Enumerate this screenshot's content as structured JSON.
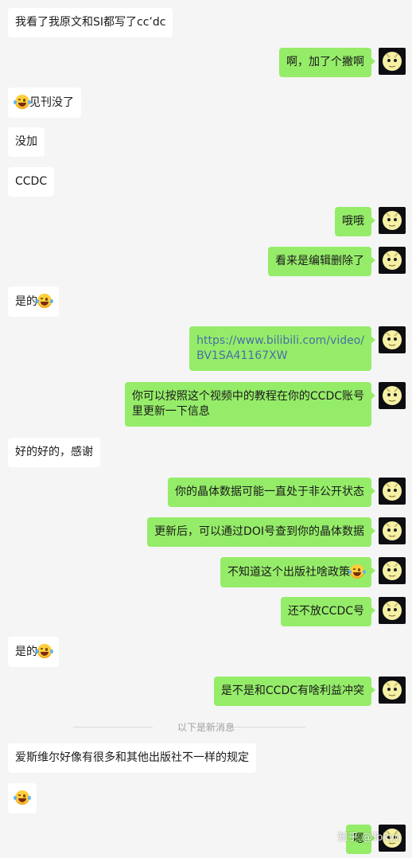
{
  "messages": [
    {
      "side": "in",
      "text": "我看了我原文和SI都写了cc’dc"
    },
    {
      "side": "out",
      "text": "啊，加了个撇啊"
    },
    {
      "side": "in",
      "text": "见刊没了",
      "emoji_before": true
    },
    {
      "side": "in",
      "text": "没加"
    },
    {
      "side": "in",
      "text": "CCDC"
    },
    {
      "side": "out",
      "text": "哦哦"
    },
    {
      "side": "out",
      "text": "看来是编辑删除了"
    },
    {
      "side": "in",
      "text": "是的",
      "emoji_after": true
    },
    {
      "side": "out",
      "text": "https://www.bilibili.com/video/BV1SA41167XW",
      "line1": "https://www.bilibili.com/video/",
      "line2": "BV1SA41167XW"
    },
    {
      "side": "out",
      "text": "你可以按照这个视频中的教程在你的CCDC账号里更新一下信息",
      "line1": "你可以按照这个视频中的教程在你的CCDC账号",
      "line2": "里更新一下信息"
    },
    {
      "side": "in",
      "text": "好的好的，感谢"
    },
    {
      "side": "out",
      "text": "你的晶体数据可能一直处于非公开状态"
    },
    {
      "side": "out",
      "text": "更新后，可以通过DOI号查到你的晶体数据"
    },
    {
      "side": "out",
      "text": "不知道这个出版社啥政策",
      "emoji_after": true
    },
    {
      "side": "out",
      "text": "还不放CCDC号"
    },
    {
      "side": "in",
      "text": "是的",
      "emoji_after": true
    },
    {
      "side": "out",
      "text": "是不是和CCDC有啥利益冲突"
    },
    {
      "side": "in",
      "text": "爱斯维尔好像有很多和其他出版社不一样的规定"
    },
    {
      "side": "in",
      "text": "",
      "emoji_only": true
    },
    {
      "side": "out",
      "text": "嗯"
    }
  ],
  "divider": {
    "text": "以下是新消息"
  },
  "watermark": {
    "text": "知乎 @Tokyo"
  },
  "emoji": {
    "name": "laughing-with-tears"
  },
  "colors": {
    "background": "#f5f5f5",
    "incoming": "#ffffff",
    "outgoing": "#95ec69",
    "link": "#4a6fa5",
    "divider": "#a0a0a0"
  }
}
